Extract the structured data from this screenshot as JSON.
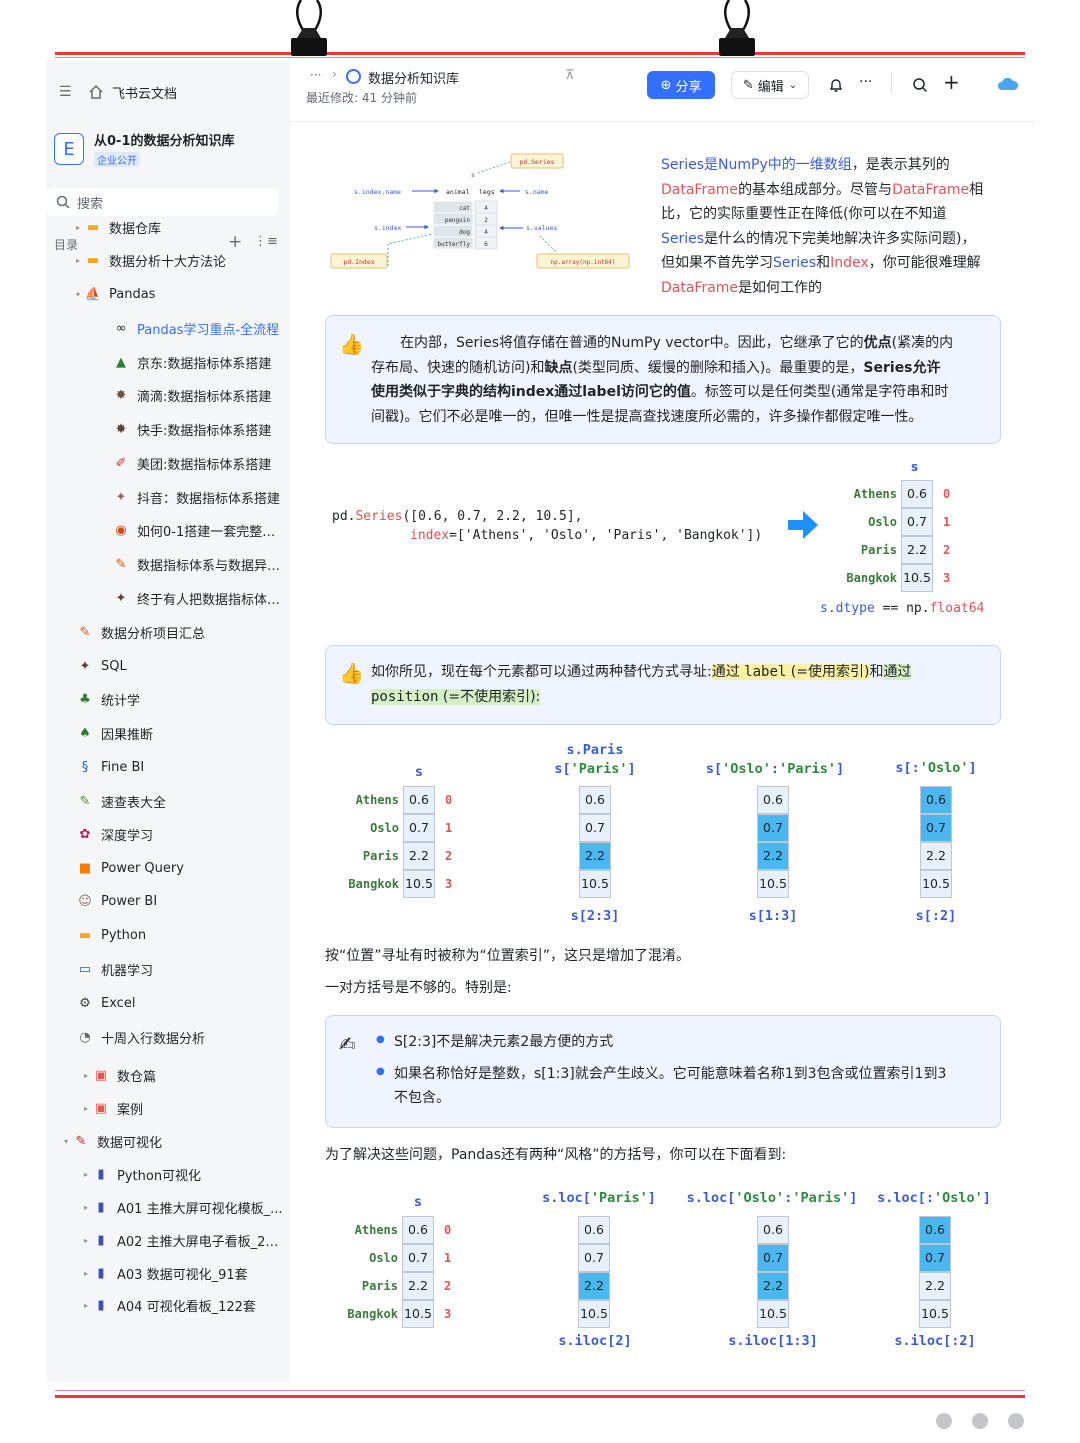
{
  "sidebar": {
    "header": "飞书云文档",
    "workspace": {
      "initial": "E",
      "name": "从0-1的数据分析知识库",
      "badge": "企业公开"
    },
    "search_placeholder": "搜索",
    "toc_label": "目录",
    "items": [
      {
        "label": "数据仓库",
        "arrow": "▸"
      },
      {
        "label": "数据分析十大方法论",
        "arrow": "▸"
      },
      {
        "label": "Pandas",
        "arrow": "▾"
      },
      {
        "label": "Pandas学习重点-全流程",
        "arrow": ""
      },
      {
        "label": "京东:数据指标体系搭建",
        "arrow": ""
      },
      {
        "label": "滴滴:数据指标体系搭建",
        "arrow": ""
      },
      {
        "label": "快手:数据指标体系搭建",
        "arrow": ""
      },
      {
        "label": "美团:数据指标体系搭建",
        "arrow": ""
      },
      {
        "label": "抖音：数据指标体系搭建",
        "arrow": ""
      },
      {
        "label": "如何0-1搭建一套完整的数...",
        "arrow": ""
      },
      {
        "label": "数据指标体系与数据异动...",
        "arrow": ""
      },
      {
        "label": "终于有人把数据指标体系...",
        "arrow": ""
      },
      {
        "label": "数据分析项目汇总",
        "arrow": ""
      },
      {
        "label": "SQL",
        "arrow": ""
      },
      {
        "label": "统计学",
        "arrow": ""
      },
      {
        "label": "因果推断",
        "arrow": ""
      },
      {
        "label": "Fine BI",
        "arrow": ""
      },
      {
        "label": "速查表大全",
        "arrow": ""
      },
      {
        "label": "深度学习",
        "arrow": ""
      },
      {
        "label": "Power Query",
        "arrow": ""
      },
      {
        "label": "Power BI",
        "arrow": ""
      },
      {
        "label": "Python",
        "arrow": ""
      },
      {
        "label": "机器学习",
        "arrow": ""
      },
      {
        "label": "Excel",
        "arrow": ""
      },
      {
        "label": "十周入行数据分析",
        "arrow": ""
      },
      {
        "label": "数仓篇",
        "arrow": "▸"
      },
      {
        "label": "案例",
        "arrow": "▸"
      },
      {
        "label": "数据可视化",
        "arrow": "▾"
      },
      {
        "label": "Python可视化",
        "arrow": "▸"
      },
      {
        "label": "A01 主推大屏可视化模板_...",
        "arrow": "▸"
      },
      {
        "label": "A02 主推大屏电子看板_20套",
        "arrow": "▸"
      },
      {
        "label": "A03 数据可视化_91套",
        "arrow": "▸"
      },
      {
        "label": "A04 可视化看板_122套",
        "arrow": "▸"
      }
    ]
  },
  "topbar": {
    "breadcrumb_more": "···",
    "title": "数据分析知识库",
    "last_modified": "最近修改: 41 分钟前",
    "share_label": "分享",
    "edit_label": "编辑",
    "more": "···"
  },
  "diagram1": {
    "pd_series": "pd.Series",
    "s": "s",
    "index_name": "s.index.name",
    "animal": "animal",
    "legs": "legs",
    "s_name": "s.name",
    "s_index": "s.index",
    "s_values": "s.values",
    "pd_index": "pd.Index",
    "np_array": "np.array(np.int64)",
    "rows": [
      {
        "k": "cat",
        "v": "4"
      },
      {
        "k": "penguin",
        "v": "2"
      },
      {
        "k": "dog",
        "v": "4"
      },
      {
        "k": "butterfly",
        "v": "6"
      }
    ]
  },
  "intro": {
    "l1a": "Series是NumPy中的一维数组",
    "l1b": "，是表示其列的",
    "l2a": "DataFrame",
    "l2b": "的基本组成部分。尽管与",
    "l2c": "DataFrame",
    "l2d": "相",
    "l3": "比，它的实际重要性正在降低(你可以在不知道",
    "l4a": "Series",
    "l4b": "是什么的情况下完美地解决许多实际问题)，",
    "l5a": "但如果不首先学习",
    "l5b": "Series",
    "l5c": "和",
    "l5d": "Index",
    "l5e": "，你可能很难理解",
    "l6a": "DataFrame",
    "l6b": "是如何工作的"
  },
  "callout1": {
    "l1a": "在内部，Series将值存储在普通的NumPy vector中。因此，它继承了它的",
    "l1b": "优点",
    "l1c": "(紧凑的内",
    "l2a": "存布局、快速的随机访问)和",
    "l2b": "缺点",
    "l2c": "(类型同质、缓慢的删除和插入)。最重要的是，",
    "l2d": "Series允许",
    "l3a": "使用类似于字典的结构index通过label访问它的值",
    "l3b": "。标签可以是任何类型(通常是字符串和时",
    "l4": "间戳)。它们不必是唯一的，但唯一性是提高查找速度所必需的，许多操作都假定唯一性。"
  },
  "code": {
    "l1a": "pd.",
    "l1b": "Series",
    "l1c": "([0.6, 0.7, 2.2, 10.5],",
    "l2a": "index",
    "l2b": "=['Athens', 'Oslo', 'Paris', 'Bangkok'])"
  },
  "series": {
    "labels": [
      "Athens",
      "Oslo",
      "Paris",
      "Bangkok"
    ],
    "values": [
      "0.6",
      "0.7",
      "2.2",
      "10.5"
    ],
    "idx": [
      "0",
      "1",
      "2",
      "3"
    ],
    "s": "s",
    "dtype_a": "s.",
    "dtype_b": "dtype",
    "dtype_c": " == np.",
    "dtype_d": "float64"
  },
  "callout2": {
    "l1a": "如你所见，现在每个元素都可以通过两种替代方式寻址:",
    "l1b": "通过 ",
    "l1c": "label",
    "l1d": " (=使用索引)",
    "l1e": "和",
    "l1f": "通过",
    "l2a": "position",
    "l2b": " (=不使用索引):"
  },
  "t1": {
    "s": "s",
    "p1": "s.Paris",
    "p2a": "s[",
    "p2b": "'Paris'",
    "p2c": "]",
    "p3a": "s[",
    "p3b": "'Oslo'",
    "p3c": ":",
    "p3d": "'Paris'",
    "p3e": "]",
    "p4a": "s[:",
    "p4b": "'Oslo'",
    "p4c": "]",
    "b1": "s[2:3]",
    "b2": "s[1:3]",
    "b3": "s[:2]"
  },
  "para1": "按“位置”寻址有时被称为“位置索引”，这只是增加了混淆。",
  "para2": "一对方括号是不够的。特别是:",
  "callout3": {
    "b1": "S[2:3]不是解决元素2最方便的方式",
    "b2a": "如果名称恰好是整数，s[1:3]就会产生歧义。它可能意味着名称1到3包含或位置索引1到3",
    "b2b": "不包含。"
  },
  "para3": "为了解决这些问题，Pandas还有两种“风格”的方括号，你可以在下面看到:",
  "t2": {
    "s": "s",
    "p1a": "s.loc[",
    "p1b": "'Paris'",
    "p1c": "]",
    "p2a": "s.loc[",
    "p2b": "'Oslo'",
    "p2c": ":",
    "p2d": "'Paris'",
    "p2e": "]",
    "p3a": "s.loc[:",
    "p3b": "'Oslo'",
    "p3c": "]",
    "b1": "s.iloc[2]",
    "b2": "s.iloc[1:3]",
    "b3": "s.iloc[:2]"
  },
  "colors": {
    "accent": "#3370ff",
    "red": "#e8383d",
    "cellHighlight": "#4ab8ef"
  }
}
